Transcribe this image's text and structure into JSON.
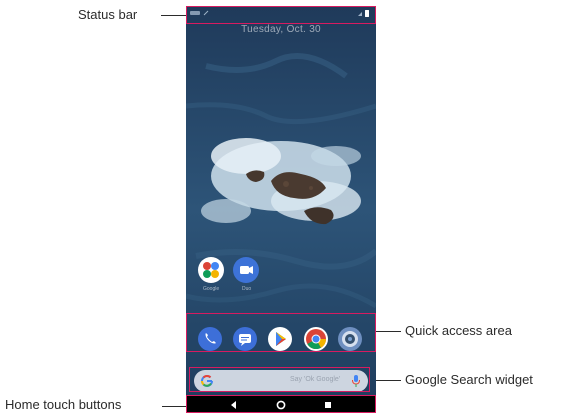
{
  "callouts": {
    "status_bar": "Status bar",
    "quick_access_area": "Quick access area",
    "google_search_widget": "Google Search widget",
    "home_touch_buttons": "Home touch buttons"
  },
  "phone": {
    "lock_date": "Tuesday, Oct. 30",
    "home_apps": [
      {
        "label": "Google",
        "icon": "google-apps-folder-icon"
      },
      {
        "label": "Duo",
        "icon": "duo-video-icon"
      }
    ],
    "dock_apps": [
      {
        "icon": "phone-icon",
        "color": "#3d6fd8"
      },
      {
        "icon": "messages-icon",
        "color": "#3d6fd8"
      },
      {
        "icon": "play-store-icon",
        "color": "#ffffff"
      },
      {
        "icon": "chrome-icon",
        "color": "#ffffff"
      },
      {
        "icon": "camera-icon",
        "color": "#6e8fc0"
      }
    ],
    "search_widget": {
      "placeholder": "Say 'Ok Google'",
      "icons": [
        "google-g-icon",
        "mic-icon"
      ]
    },
    "navbar_buttons": [
      "back-icon",
      "home-icon",
      "recents-icon"
    ]
  },
  "colors": {
    "highlight": "#d81b60",
    "navbar": "#000000"
  }
}
